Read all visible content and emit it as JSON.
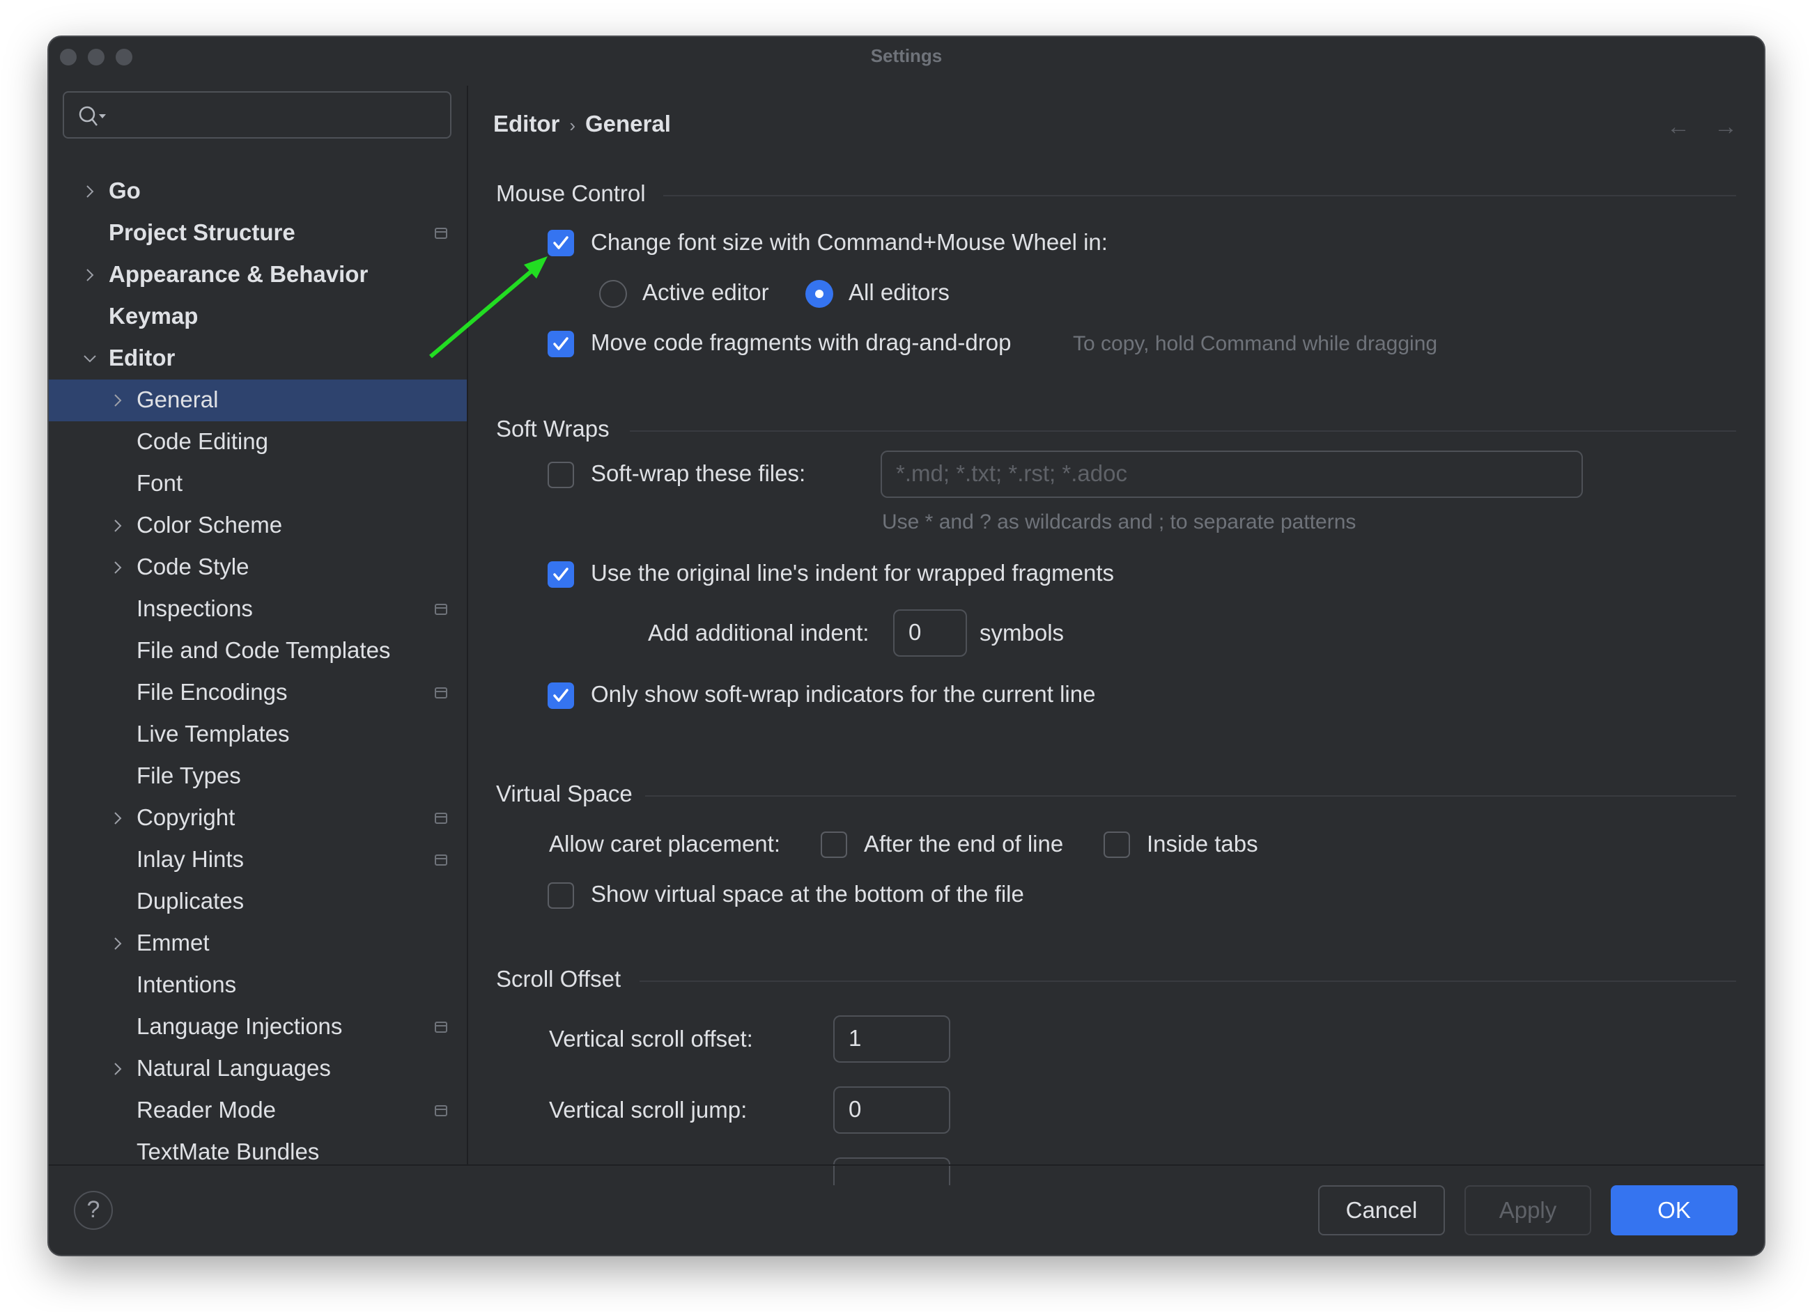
{
  "window": {
    "title": "Settings"
  },
  "search": {
    "placeholder": "",
    "icon": "search-icon"
  },
  "sidebar": {
    "items": [
      {
        "label": "Go",
        "bold": true,
        "expander": "collapsed",
        "page_icon": false
      },
      {
        "label": "Project Structure",
        "bold": true,
        "expander": "none",
        "page_icon": true
      },
      {
        "label": "Appearance & Behavior",
        "bold": true,
        "expander": "collapsed",
        "page_icon": false
      },
      {
        "label": "Keymap",
        "bold": true,
        "expander": "none",
        "page_icon": false
      },
      {
        "label": "Editor",
        "bold": true,
        "expander": "expanded",
        "page_icon": false
      },
      {
        "label": "General",
        "bold": false,
        "expander": "collapsed",
        "page_icon": false,
        "selected": true
      },
      {
        "label": "Code Editing",
        "bold": false,
        "expander": "none",
        "page_icon": false
      },
      {
        "label": "Font",
        "bold": false,
        "expander": "none",
        "page_icon": false
      },
      {
        "label": "Color Scheme",
        "bold": false,
        "expander": "collapsed",
        "page_icon": false
      },
      {
        "label": "Code Style",
        "bold": false,
        "expander": "collapsed",
        "page_icon": false
      },
      {
        "label": "Inspections",
        "bold": false,
        "expander": "none",
        "page_icon": true
      },
      {
        "label": "File and Code Templates",
        "bold": false,
        "expander": "none",
        "page_icon": false
      },
      {
        "label": "File Encodings",
        "bold": false,
        "expander": "none",
        "page_icon": true
      },
      {
        "label": "Live Templates",
        "bold": false,
        "expander": "none",
        "page_icon": false
      },
      {
        "label": "File Types",
        "bold": false,
        "expander": "none",
        "page_icon": false
      },
      {
        "label": "Copyright",
        "bold": false,
        "expander": "collapsed",
        "page_icon": true
      },
      {
        "label": "Inlay Hints",
        "bold": false,
        "expander": "none",
        "page_icon": true
      },
      {
        "label": "Duplicates",
        "bold": false,
        "expander": "none",
        "page_icon": false
      },
      {
        "label": "Emmet",
        "bold": false,
        "expander": "collapsed",
        "page_icon": false
      },
      {
        "label": "Intentions",
        "bold": false,
        "expander": "none",
        "page_icon": false
      },
      {
        "label": "Language Injections",
        "bold": false,
        "expander": "none",
        "page_icon": true
      },
      {
        "label": "Natural Languages",
        "bold": false,
        "expander": "collapsed",
        "page_icon": false
      },
      {
        "label": "Reader Mode",
        "bold": false,
        "expander": "none",
        "page_icon": true
      },
      {
        "label": "TextMate Bundles",
        "bold": false,
        "expander": "none",
        "page_icon": false
      }
    ]
  },
  "breadcrumb": {
    "parent": "Editor",
    "separator": "›",
    "current": "General"
  },
  "nav": {
    "back": "←",
    "forward": "→"
  },
  "mouse_control": {
    "title": "Mouse Control",
    "change_font_size": {
      "label": "Change font size with Command+Mouse Wheel in:",
      "checked": true
    },
    "radio_active_editor": {
      "label": "Active editor",
      "selected": false
    },
    "radio_all_editors": {
      "label": "All editors",
      "selected": true
    },
    "move_code": {
      "label": "Move code fragments with drag-and-drop",
      "checked": true,
      "hint": "To copy, hold Command while dragging"
    }
  },
  "soft_wraps": {
    "title": "Soft Wraps",
    "soft_wrap_files": {
      "label": "Soft-wrap these files:",
      "checked": false,
      "placeholder": "*.md; *.txt; *.rst; *.adoc",
      "value": "",
      "hint": "Use * and ? as wildcards and ; to separate patterns"
    },
    "original_indent": {
      "label": "Use the original line's indent for wrapped fragments",
      "checked": true
    },
    "additional_indent": {
      "label": "Add additional indent:",
      "value": "0",
      "suffix": "symbols"
    },
    "only_current_line": {
      "label": "Only show soft-wrap indicators for the current line",
      "checked": true
    }
  },
  "virtual_space": {
    "title": "Virtual Space",
    "allow_caret_label": "Allow caret placement:",
    "after_end_of_line": {
      "label": "After the end of line",
      "checked": false
    },
    "inside_tabs": {
      "label": "Inside tabs",
      "checked": false
    },
    "show_virtual_space": {
      "label": "Show virtual space at the bottom of the file",
      "checked": false
    }
  },
  "scroll_offset": {
    "title": "Scroll Offset",
    "vertical_offset": {
      "label": "Vertical scroll offset:",
      "value": "1"
    },
    "vertical_jump": {
      "label": "Vertical scroll jump:",
      "value": "0"
    }
  },
  "footer": {
    "help": "?",
    "cancel": "Cancel",
    "apply": "Apply",
    "ok": "OK"
  },
  "colors": {
    "accent": "#3574f0",
    "selection": "#2e436e",
    "background": "#2b2d30",
    "annotation_arrow": "#22dd22"
  }
}
